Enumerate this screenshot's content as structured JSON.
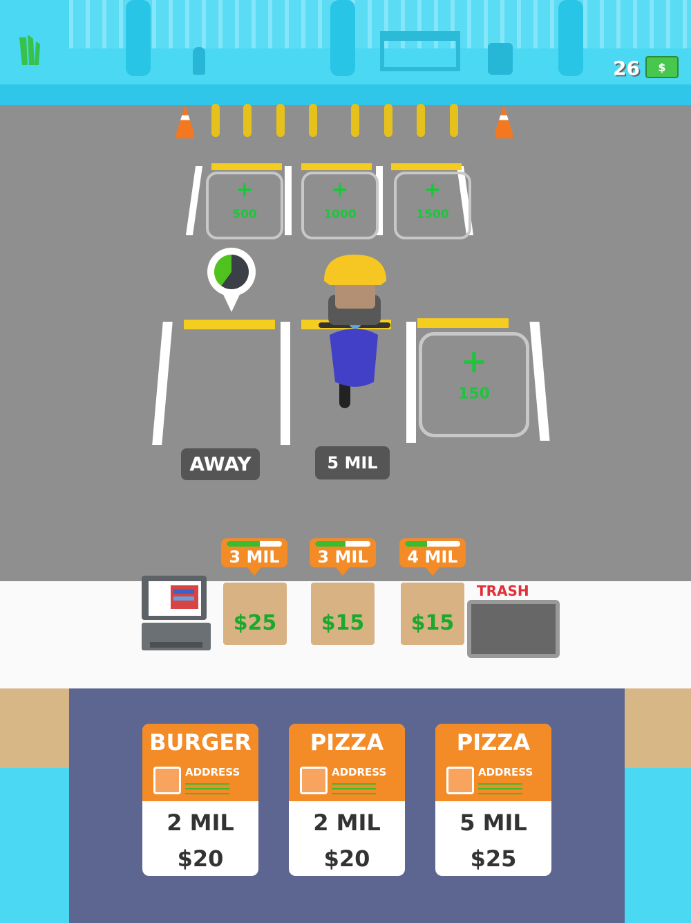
{
  "hud": {
    "money": "26",
    "money_icon": "dollar-bill-icon"
  },
  "parking_upgrades": [
    {
      "price": "500"
    },
    {
      "price": "1000"
    },
    {
      "price": "1500"
    }
  ],
  "parking_lower": {
    "slot1_label": "AWAY",
    "slot2_label": "5 MIL",
    "slot3_price": "150",
    "timer_progress": 0.4
  },
  "counter_bags": [
    {
      "distance": "3 MIL",
      "price": "$25",
      "progress": 0.6
    },
    {
      "distance": "3 MIL",
      "price": "$15",
      "progress": 0.55
    },
    {
      "distance": "4 MIL",
      "price": "$15",
      "progress": 0.4
    }
  ],
  "trash_label": "TRASH",
  "orders": [
    {
      "item": "BURGER",
      "address_label": "ADDRESS",
      "distance": "2 MIL",
      "price": "$20"
    },
    {
      "item": "PIZZA",
      "address_label": "ADDRESS",
      "distance": "2 MIL",
      "price": "$20"
    },
    {
      "item": "PIZZA",
      "address_label": "ADDRESS",
      "distance": "5 MIL",
      "price": "$25"
    }
  ],
  "colors": {
    "accent": "#f38b27",
    "money_green": "#1ec53c",
    "panel": "#5d6591",
    "sky_blue": "#4ad8f2"
  }
}
